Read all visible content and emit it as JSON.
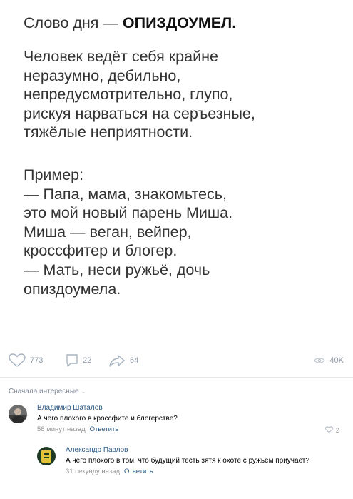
{
  "post": {
    "title_prefix": "Слово дня — ",
    "title_word": "ОПИЗДОУМЕЛ.",
    "definition_lines": [
      "Человек ведёт себя крайне",
      "неразумно, дебильно,",
      "непредусмотрительно, глупо,",
      "рискуя нарваться на серъезные,",
      "тяжёлые неприятности."
    ],
    "example_lines": [
      "Пример:",
      "— Папа, мама, знакомьтесь,",
      "это мой новый парень Миша.",
      "Миша — веган, вейпер,",
      "кроссфитер и блогер.",
      "— Мать, неси ружьё, дочь",
      "опиздоумела."
    ]
  },
  "actions": {
    "likes": "773",
    "comments": "22",
    "shares": "64",
    "views": "40K"
  },
  "comments_sort": {
    "label": "Сначала интересные"
  },
  "comments": [
    {
      "author": "Владимир Шаталов",
      "text": "А чего плохого в кроссфите и блогерстве?",
      "time": "58 минут назад",
      "reply_label": "Ответить",
      "likes": "2"
    },
    {
      "author": "Александр Павлов",
      "text": "А чего плохого в том, что будущий тесть зятя к охоте с ружьем приучает?",
      "time": "31 секунду назад",
      "reply_label": "Ответить"
    }
  ]
}
